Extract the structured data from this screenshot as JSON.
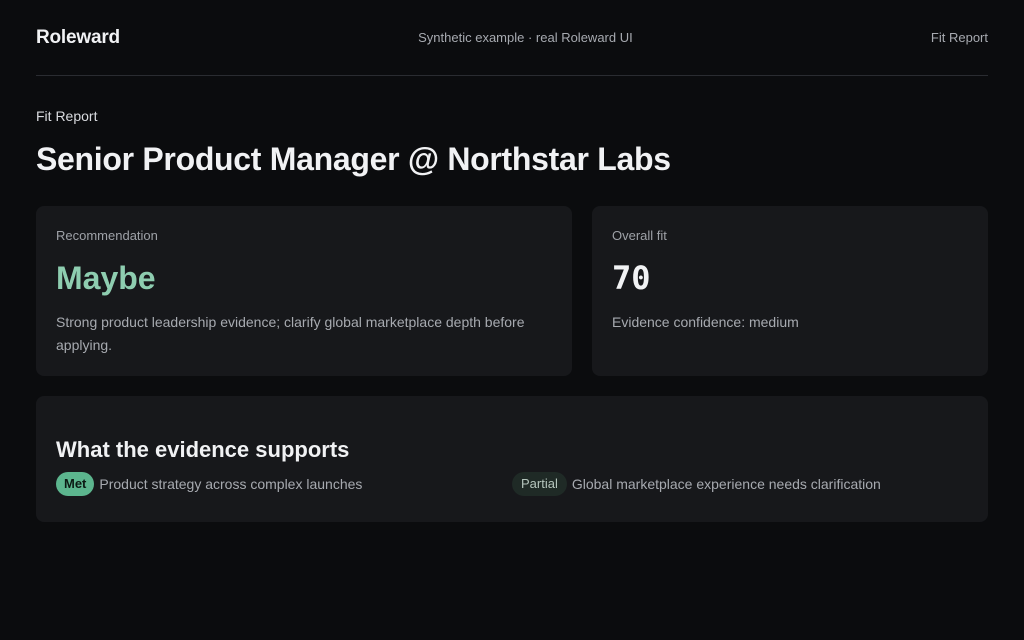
{
  "header": {
    "brand": "Roleward",
    "tagline": "Synthetic example · real Roleward UI",
    "nav_link": "Fit Report"
  },
  "page": {
    "eyebrow": "Fit Report",
    "title": "Senior Product Manager @ Northstar Labs"
  },
  "recommendation": {
    "label": "Recommendation",
    "value": "Maybe",
    "description": "Strong product leadership evidence; clarify global marketplace depth before applying."
  },
  "overall_fit": {
    "label": "Overall fit",
    "score": "70",
    "confidence": "Evidence confidence: medium"
  },
  "evidence": {
    "title": "What the evidence supports",
    "items": [
      {
        "status": "Met",
        "text": "Product strategy across complex launches"
      },
      {
        "status": "Partial",
        "text": "Global marketplace experience needs clarification"
      }
    ]
  },
  "colors": {
    "background": "#0b0c0e",
    "card": "#17181b",
    "accent_green": "#8ecdb0",
    "badge_met": "#5cb58e",
    "badge_partial": "#1f2a26"
  }
}
